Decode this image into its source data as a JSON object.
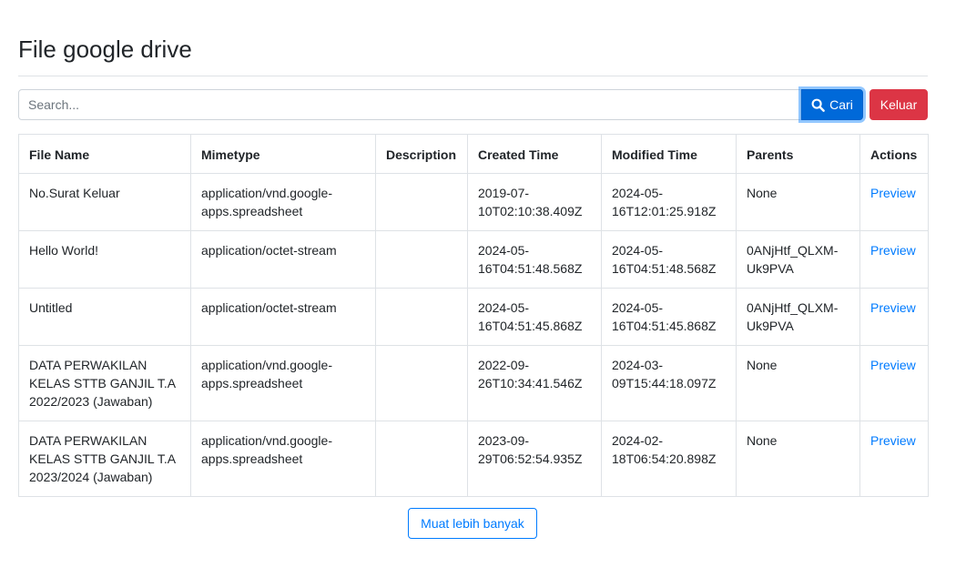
{
  "page": {
    "title": "File google drive"
  },
  "search": {
    "placeholder": "Search...",
    "value": "",
    "search_button_label": "Cari",
    "search_icon": "search-icon",
    "logout_button_label": "Keluar"
  },
  "colors": {
    "primary": "#007bff",
    "danger": "#dc3545",
    "border": "#dee2e6"
  },
  "table": {
    "headers": [
      "File Name",
      "Mimetype",
      "Description",
      "Created Time",
      "Modified Time",
      "Parents",
      "Actions"
    ],
    "rows": [
      {
        "file_name": "No.Surat Keluar",
        "mimetype": "application/vnd.google-apps.spreadsheet",
        "description": "",
        "created_time": "2019-07-10T02:10:38.409Z",
        "modified_time": "2024-05-16T12:01:25.918Z",
        "parents": "None",
        "action": "Preview"
      },
      {
        "file_name": "Hello World!",
        "mimetype": "application/octet-stream",
        "description": "",
        "created_time": "2024-05-16T04:51:48.568Z",
        "modified_time": "2024-05-16T04:51:48.568Z",
        "parents": "0ANjHtf_QLXM-Uk9PVA",
        "action": "Preview"
      },
      {
        "file_name": "Untitled",
        "mimetype": "application/octet-stream",
        "description": "",
        "created_time": "2024-05-16T04:51:45.868Z",
        "modified_time": "2024-05-16T04:51:45.868Z",
        "parents": "0ANjHtf_QLXM-Uk9PVA",
        "action": "Preview"
      },
      {
        "file_name": "DATA PERWAKILAN KELAS STTB GANJIL T.A 2022/2023 (Jawaban)",
        "mimetype": "application/vnd.google-apps.spreadsheet",
        "description": "",
        "created_time": "2022-09-26T10:34:41.546Z",
        "modified_time": "2024-03-09T15:44:18.097Z",
        "parents": "None",
        "action": "Preview"
      },
      {
        "file_name": "DATA PERWAKILAN KELAS STTB GANJIL T.A 2023/2024 (Jawaban)",
        "mimetype": "application/vnd.google-apps.spreadsheet",
        "description": "",
        "created_time": "2023-09-29T06:52:54.935Z",
        "modified_time": "2024-02-18T06:54:20.898Z",
        "parents": "None",
        "action": "Preview"
      }
    ]
  },
  "load_more": {
    "label": "Muat lebih banyak"
  }
}
